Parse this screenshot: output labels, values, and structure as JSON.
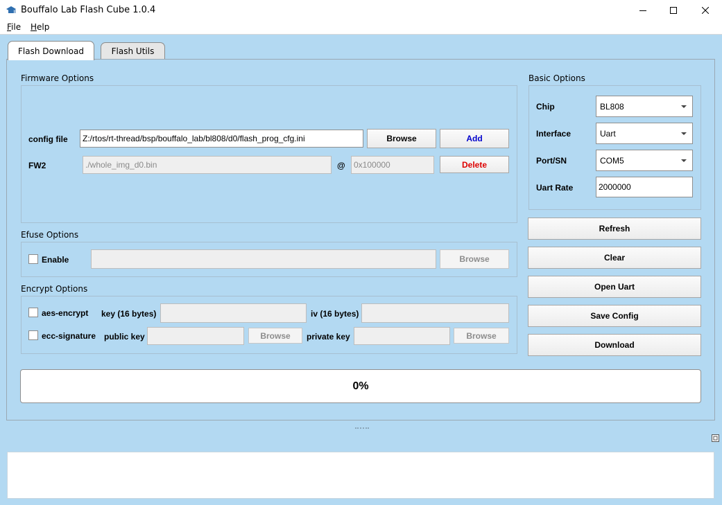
{
  "window": {
    "title": "Bouffalo Lab Flash Cube 1.0.4"
  },
  "menu": {
    "file": {
      "underlined": "F",
      "rest": "ile"
    },
    "help": {
      "underlined": "H",
      "rest": "elp"
    }
  },
  "tabs": [
    {
      "label": "Flash Download",
      "active": true
    },
    {
      "label": "Flash Utils",
      "active": false
    }
  ],
  "firmware": {
    "title": "Firmware Options",
    "config_label": "config file",
    "config_value": "Z:/rtos/rt-thread/bsp/bouffalo_lab/bl808/d0/flash_prog_cfg.ini",
    "browse_label": "Browse",
    "add_label": "Add",
    "fw2_label": "FW2",
    "fw2_value": "./whole_img_d0.bin",
    "at_label": "@",
    "fw2_address": "0x100000",
    "delete_label": "Delete"
  },
  "efuse": {
    "title": "Efuse Options",
    "enable_label": "Enable",
    "path_value": "",
    "browse_label": "Browse"
  },
  "encrypt": {
    "title": "Encrypt Options",
    "aes_label": "aes-encrypt",
    "key_label": "key (16 bytes)",
    "iv_label": "iv (16 bytes)",
    "ecc_label": "ecc-signature",
    "public_key_label": "public key",
    "public_browse_label": "Browse",
    "private_key_label": "private key",
    "private_browse_label": "Browse"
  },
  "basic": {
    "title": "Basic Options",
    "chip_label": "Chip",
    "chip_value": "BL808",
    "interface_label": "Interface",
    "interface_value": "Uart",
    "port_label": "Port/SN",
    "port_value": "COM5",
    "uart_rate_label": "Uart Rate",
    "uart_rate_value": "2000000"
  },
  "actions": {
    "refresh": "Refresh",
    "clear": "Clear",
    "open_uart": "Open Uart",
    "save_config": "Save Config",
    "download": "Download"
  },
  "progress": {
    "text": "0%",
    "value": 0
  },
  "colors": {
    "background": "#b3d9f2",
    "add_text": "#0000cc",
    "delete_text": "#dd0000"
  },
  "icons": {
    "app": "app-icon",
    "minimize": "minimize-icon",
    "maximize": "maximize-icon",
    "close": "close-icon",
    "dropdown": "chevron-down-icon",
    "restore": "restore-icon"
  }
}
